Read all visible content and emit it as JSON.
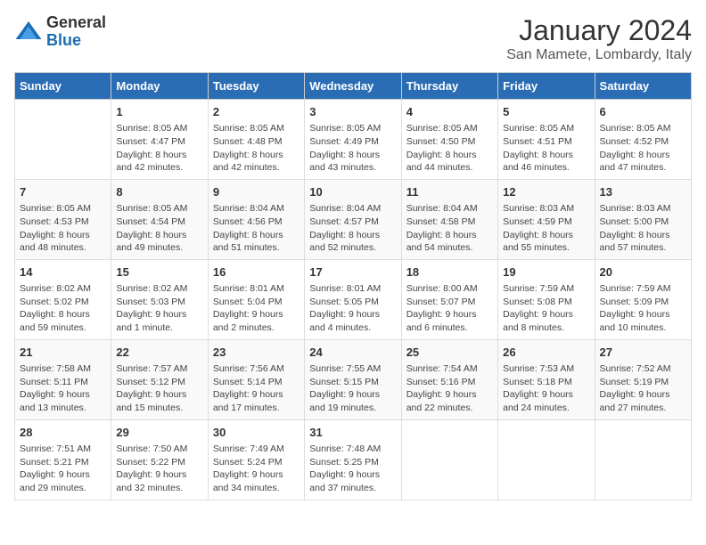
{
  "logo": {
    "general": "General",
    "blue": "Blue"
  },
  "title": "January 2024",
  "location": "San Mamete, Lombardy, Italy",
  "headers": [
    "Sunday",
    "Monday",
    "Tuesday",
    "Wednesday",
    "Thursday",
    "Friday",
    "Saturday"
  ],
  "weeks": [
    [
      {
        "day": "",
        "sunrise": "",
        "sunset": "",
        "daylight": ""
      },
      {
        "day": "1",
        "sunrise": "Sunrise: 8:05 AM",
        "sunset": "Sunset: 4:47 PM",
        "daylight": "Daylight: 8 hours and 42 minutes."
      },
      {
        "day": "2",
        "sunrise": "Sunrise: 8:05 AM",
        "sunset": "Sunset: 4:48 PM",
        "daylight": "Daylight: 8 hours and 42 minutes."
      },
      {
        "day": "3",
        "sunrise": "Sunrise: 8:05 AM",
        "sunset": "Sunset: 4:49 PM",
        "daylight": "Daylight: 8 hours and 43 minutes."
      },
      {
        "day": "4",
        "sunrise": "Sunrise: 8:05 AM",
        "sunset": "Sunset: 4:50 PM",
        "daylight": "Daylight: 8 hours and 44 minutes."
      },
      {
        "day": "5",
        "sunrise": "Sunrise: 8:05 AM",
        "sunset": "Sunset: 4:51 PM",
        "daylight": "Daylight: 8 hours and 46 minutes."
      },
      {
        "day": "6",
        "sunrise": "Sunrise: 8:05 AM",
        "sunset": "Sunset: 4:52 PM",
        "daylight": "Daylight: 8 hours and 47 minutes."
      }
    ],
    [
      {
        "day": "7",
        "sunrise": "Sunrise: 8:05 AM",
        "sunset": "Sunset: 4:53 PM",
        "daylight": "Daylight: 8 hours and 48 minutes."
      },
      {
        "day": "8",
        "sunrise": "Sunrise: 8:05 AM",
        "sunset": "Sunset: 4:54 PM",
        "daylight": "Daylight: 8 hours and 49 minutes."
      },
      {
        "day": "9",
        "sunrise": "Sunrise: 8:04 AM",
        "sunset": "Sunset: 4:56 PM",
        "daylight": "Daylight: 8 hours and 51 minutes."
      },
      {
        "day": "10",
        "sunrise": "Sunrise: 8:04 AM",
        "sunset": "Sunset: 4:57 PM",
        "daylight": "Daylight: 8 hours and 52 minutes."
      },
      {
        "day": "11",
        "sunrise": "Sunrise: 8:04 AM",
        "sunset": "Sunset: 4:58 PM",
        "daylight": "Daylight: 8 hours and 54 minutes."
      },
      {
        "day": "12",
        "sunrise": "Sunrise: 8:03 AM",
        "sunset": "Sunset: 4:59 PM",
        "daylight": "Daylight: 8 hours and 55 minutes."
      },
      {
        "day": "13",
        "sunrise": "Sunrise: 8:03 AM",
        "sunset": "Sunset: 5:00 PM",
        "daylight": "Daylight: 8 hours and 57 minutes."
      }
    ],
    [
      {
        "day": "14",
        "sunrise": "Sunrise: 8:02 AM",
        "sunset": "Sunset: 5:02 PM",
        "daylight": "Daylight: 8 hours and 59 minutes."
      },
      {
        "day": "15",
        "sunrise": "Sunrise: 8:02 AM",
        "sunset": "Sunset: 5:03 PM",
        "daylight": "Daylight: 9 hours and 1 minute."
      },
      {
        "day": "16",
        "sunrise": "Sunrise: 8:01 AM",
        "sunset": "Sunset: 5:04 PM",
        "daylight": "Daylight: 9 hours and 2 minutes."
      },
      {
        "day": "17",
        "sunrise": "Sunrise: 8:01 AM",
        "sunset": "Sunset: 5:05 PM",
        "daylight": "Daylight: 9 hours and 4 minutes."
      },
      {
        "day": "18",
        "sunrise": "Sunrise: 8:00 AM",
        "sunset": "Sunset: 5:07 PM",
        "daylight": "Daylight: 9 hours and 6 minutes."
      },
      {
        "day": "19",
        "sunrise": "Sunrise: 7:59 AM",
        "sunset": "Sunset: 5:08 PM",
        "daylight": "Daylight: 9 hours and 8 minutes."
      },
      {
        "day": "20",
        "sunrise": "Sunrise: 7:59 AM",
        "sunset": "Sunset: 5:09 PM",
        "daylight": "Daylight: 9 hours and 10 minutes."
      }
    ],
    [
      {
        "day": "21",
        "sunrise": "Sunrise: 7:58 AM",
        "sunset": "Sunset: 5:11 PM",
        "daylight": "Daylight: 9 hours and 13 minutes."
      },
      {
        "day": "22",
        "sunrise": "Sunrise: 7:57 AM",
        "sunset": "Sunset: 5:12 PM",
        "daylight": "Daylight: 9 hours and 15 minutes."
      },
      {
        "day": "23",
        "sunrise": "Sunrise: 7:56 AM",
        "sunset": "Sunset: 5:14 PM",
        "daylight": "Daylight: 9 hours and 17 minutes."
      },
      {
        "day": "24",
        "sunrise": "Sunrise: 7:55 AM",
        "sunset": "Sunset: 5:15 PM",
        "daylight": "Daylight: 9 hours and 19 minutes."
      },
      {
        "day": "25",
        "sunrise": "Sunrise: 7:54 AM",
        "sunset": "Sunset: 5:16 PM",
        "daylight": "Daylight: 9 hours and 22 minutes."
      },
      {
        "day": "26",
        "sunrise": "Sunrise: 7:53 AM",
        "sunset": "Sunset: 5:18 PM",
        "daylight": "Daylight: 9 hours and 24 minutes."
      },
      {
        "day": "27",
        "sunrise": "Sunrise: 7:52 AM",
        "sunset": "Sunset: 5:19 PM",
        "daylight": "Daylight: 9 hours and 27 minutes."
      }
    ],
    [
      {
        "day": "28",
        "sunrise": "Sunrise: 7:51 AM",
        "sunset": "Sunset: 5:21 PM",
        "daylight": "Daylight: 9 hours and 29 minutes."
      },
      {
        "day": "29",
        "sunrise": "Sunrise: 7:50 AM",
        "sunset": "Sunset: 5:22 PM",
        "daylight": "Daylight: 9 hours and 32 minutes."
      },
      {
        "day": "30",
        "sunrise": "Sunrise: 7:49 AM",
        "sunset": "Sunset: 5:24 PM",
        "daylight": "Daylight: 9 hours and 34 minutes."
      },
      {
        "day": "31",
        "sunrise": "Sunrise: 7:48 AM",
        "sunset": "Sunset: 5:25 PM",
        "daylight": "Daylight: 9 hours and 37 minutes."
      },
      {
        "day": "",
        "sunrise": "",
        "sunset": "",
        "daylight": ""
      },
      {
        "day": "",
        "sunrise": "",
        "sunset": "",
        "daylight": ""
      },
      {
        "day": "",
        "sunrise": "",
        "sunset": "",
        "daylight": ""
      }
    ]
  ]
}
